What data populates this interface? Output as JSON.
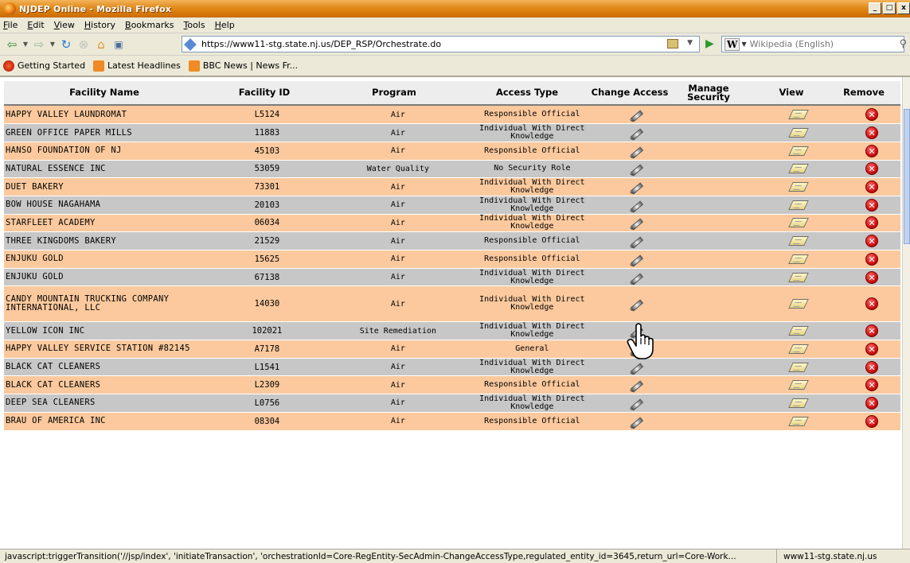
{
  "window": {
    "title": "NJDEP Online - Mozilla Firefox"
  },
  "menu": [
    "File",
    "Edit",
    "View",
    "History",
    "Bookmarks",
    "Tools",
    "Help"
  ],
  "address": {
    "url": "https://www11-stg.state.nj.us/DEP_RSP/Orchestrate.do"
  },
  "search": {
    "engine_logo": "W",
    "placeholder": "Wikipedia (English)"
  },
  "bookmarks": [
    {
      "label": "Getting Started",
      "icon": "firefox-icon"
    },
    {
      "label": "Latest Headlines",
      "icon": "rss-icon"
    },
    {
      "label": "BBC News | News Fr...",
      "icon": "rss-icon"
    }
  ],
  "table": {
    "headers": [
      "Facility Name",
      "Facility ID",
      "Program",
      "Access Type",
      "Change Access",
      "Manage Security",
      "View",
      "Remove"
    ],
    "rows": [
      {
        "name": "HAPPY VALLEY LAUNDROMAT",
        "id": "L5124",
        "program": "Air",
        "access": "Responsible Official"
      },
      {
        "name": "GREEN OFFICE PAPER MILLS",
        "id": "11883",
        "program": "Air",
        "access": "Individual With Direct Knowledge"
      },
      {
        "name": "HANSO FOUNDATION OF NJ",
        "id": "45103",
        "program": "Air",
        "access": "Responsible Official"
      },
      {
        "name": "NATURAL ESSENCE INC",
        "id": "53059",
        "program": "Water Quality",
        "access": "No Security Role"
      },
      {
        "name": "DUET BAKERY",
        "id": "73301",
        "program": "Air",
        "access": "Individual With Direct Knowledge"
      },
      {
        "name": "BOW HOUSE NAGAHAMA",
        "id": "20103",
        "program": "Air",
        "access": "Individual With Direct Knowledge"
      },
      {
        "name": "STARFLEET ACADEMY",
        "id": "06034",
        "program": "Air",
        "access": "Individual With Direct Knowledge"
      },
      {
        "name": "THREE KINGDOMS BAKERY",
        "id": "21529",
        "program": "Air",
        "access": "Responsible Official"
      },
      {
        "name": "ENJUKU GOLD",
        "id": "15625",
        "program": "Air",
        "access": "Responsible Official"
      },
      {
        "name": "ENJUKU GOLD",
        "id": "67138",
        "program": "Air",
        "access": "Individual With Direct Knowledge"
      },
      {
        "name": "CANDY MOUNTAIN TRUCKING COMPANY INTERNATIONAL, LLC",
        "id": "14030",
        "program": "Air",
        "access": "Individual With Direct Knowledge"
      },
      {
        "name": "YELLOW ICON INC",
        "id": "102021",
        "program": "Site Remediation",
        "access": "Individual With Direct Knowledge"
      },
      {
        "name": "HAPPY VALLEY SERVICE STATION #82145",
        "id": "A7178",
        "program": "Air",
        "access": "General"
      },
      {
        "name": "BLACK CAT CLEANERS",
        "id": "L1541",
        "program": "Air",
        "access": "Individual With Direct Knowledge"
      },
      {
        "name": "BLACK CAT CLEANERS",
        "id": "L2309",
        "program": "Air",
        "access": "Responsible Official"
      },
      {
        "name": "DEEP SEA CLEANERS",
        "id": "L0756",
        "program": "Air",
        "access": "Individual With Direct Knowledge"
      },
      {
        "name": "BRAU OF AMERICA INC",
        "id": "08304",
        "program": "Air",
        "access": "Responsible Official"
      }
    ]
  },
  "status": {
    "message": "javascript:triggerTransition('//jsp/index', 'initiateTransaction', 'orchestrationId=Core-RegEntity-SecAdmin-ChangeAccessType,regulated_entity_id=3645,return_url=Core-Work...",
    "domain": "www11-stg.state.nj.us"
  },
  "colors": {
    "row_odd": "#fbc99d",
    "row_even": "#c7c7c7",
    "header_bg": "#ededed",
    "titlebar": "#e08a1a"
  }
}
